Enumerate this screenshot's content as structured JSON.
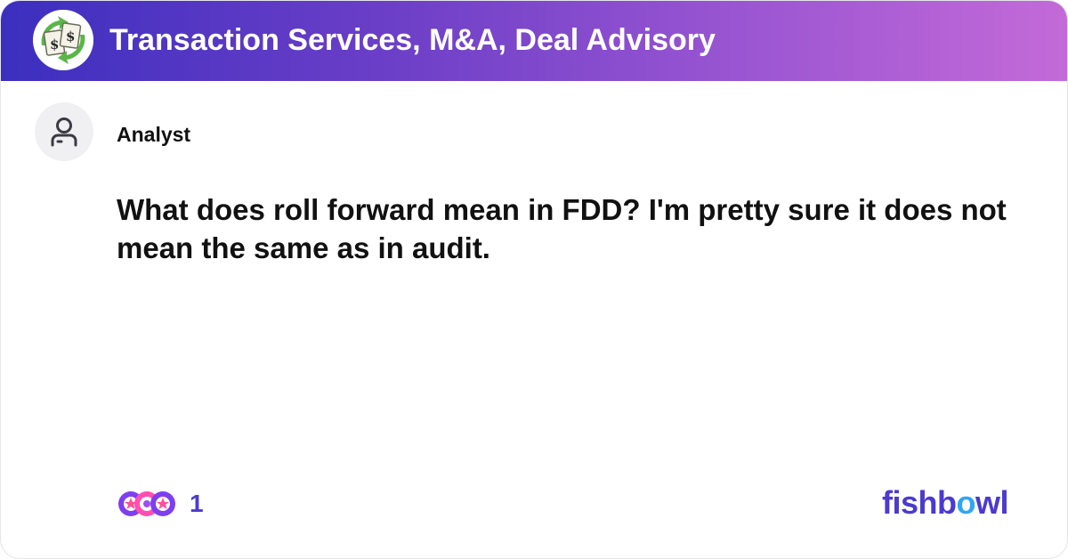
{
  "header": {
    "bowl_title": "Transaction Services, M&A, Deal Advisory",
    "bowl_logo_icon": "money-recycle-icon",
    "gradient_start": "#3c2fbf",
    "gradient_end": "#c46ad8"
  },
  "post": {
    "author": "Analyst",
    "avatar_icon": "user-icon",
    "text": "What does roll forward mean in FDD? I'm pretty sure it does not mean the same as in audit."
  },
  "footer": {
    "reactions_icon": "reaction-stack-icon",
    "reaction_count": "1",
    "brand_before": "fishb",
    "brand_o": "o",
    "brand_after": "wl",
    "accent_color": "#4b3ad0",
    "brand_o_color": "#2fa6f3"
  }
}
